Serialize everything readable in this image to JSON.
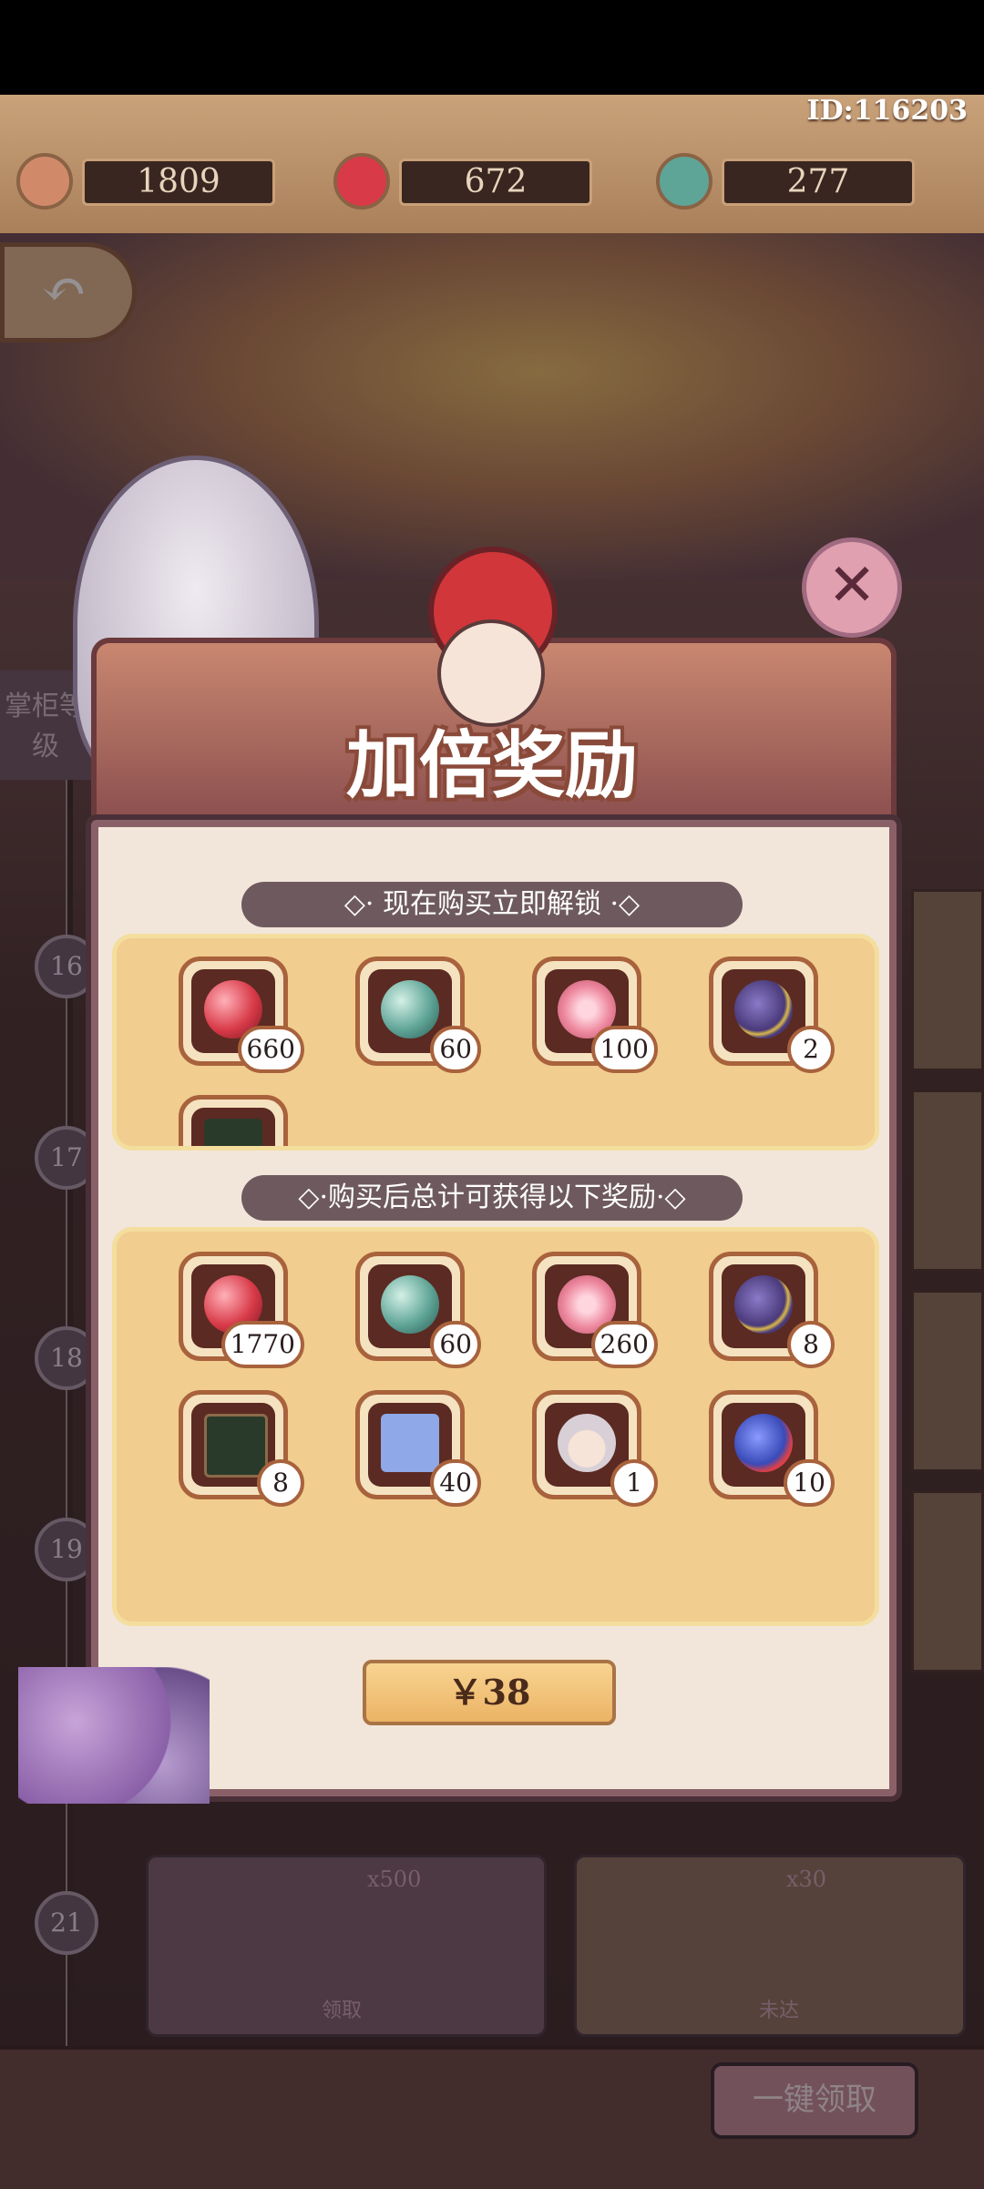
{
  "header": {
    "user_id": "ID:116203",
    "resources": [
      {
        "icon": "scroll-icon",
        "value": "1809"
      },
      {
        "icon": "red-pearl-icon",
        "value": "672"
      },
      {
        "icon": "jade-bead-icon",
        "value": "277"
      }
    ]
  },
  "background": {
    "side_label": "掌柜等级",
    "levels": [
      "16",
      "17",
      "18",
      "19",
      "21"
    ],
    "claim_all": "一键领取",
    "card_left_count": "x500",
    "card_left_label": "领取",
    "card_right_count": "x30",
    "card_right_label": "未达"
  },
  "popup": {
    "title": "加倍奖励",
    "section1_label": "◇· 现在购买立即解锁 ·◇",
    "unlock_items": [
      {
        "icon": "red-pearl-icon",
        "count": "660"
      },
      {
        "icon": "jade-bead-icon",
        "count": "60"
      },
      {
        "icon": "sakura-icon",
        "count": "100"
      },
      {
        "icon": "purple-orb-icon",
        "count": "2"
      },
      {
        "icon": "blackboard-icon",
        "count": ""
      }
    ],
    "section2_label": "◇·购买后总计可获得以下奖励·◇",
    "total_items": [
      {
        "icon": "red-pearl-icon",
        "count": "1770"
      },
      {
        "icon": "jade-bead-icon",
        "count": "60"
      },
      {
        "icon": "sakura-icon",
        "count": "260"
      },
      {
        "icon": "purple-orb-icon",
        "count": "8"
      },
      {
        "icon": "blackboard-icon",
        "count": "8"
      },
      {
        "icon": "blue-scroll-icon",
        "count": "40"
      },
      {
        "icon": "character-avatar-icon",
        "count": "1"
      },
      {
        "icon": "potion-icon",
        "count": "10"
      }
    ],
    "price": "￥38"
  },
  "colors": {
    "red-pearl-icon": "#d83a48",
    "jade-bead-icon": "#5fa597",
    "sakura-icon": "#ee8aa0",
    "purple-orb-icon": "#4a3a7a",
    "blackboard-icon": "#2a3a2a",
    "blue-scroll-icon": "#8fa8e8",
    "character-avatar-icon": "#d9cfd6",
    "potion-icon": "#3a4ab8",
    "scroll-icon": "#d08a6a"
  }
}
